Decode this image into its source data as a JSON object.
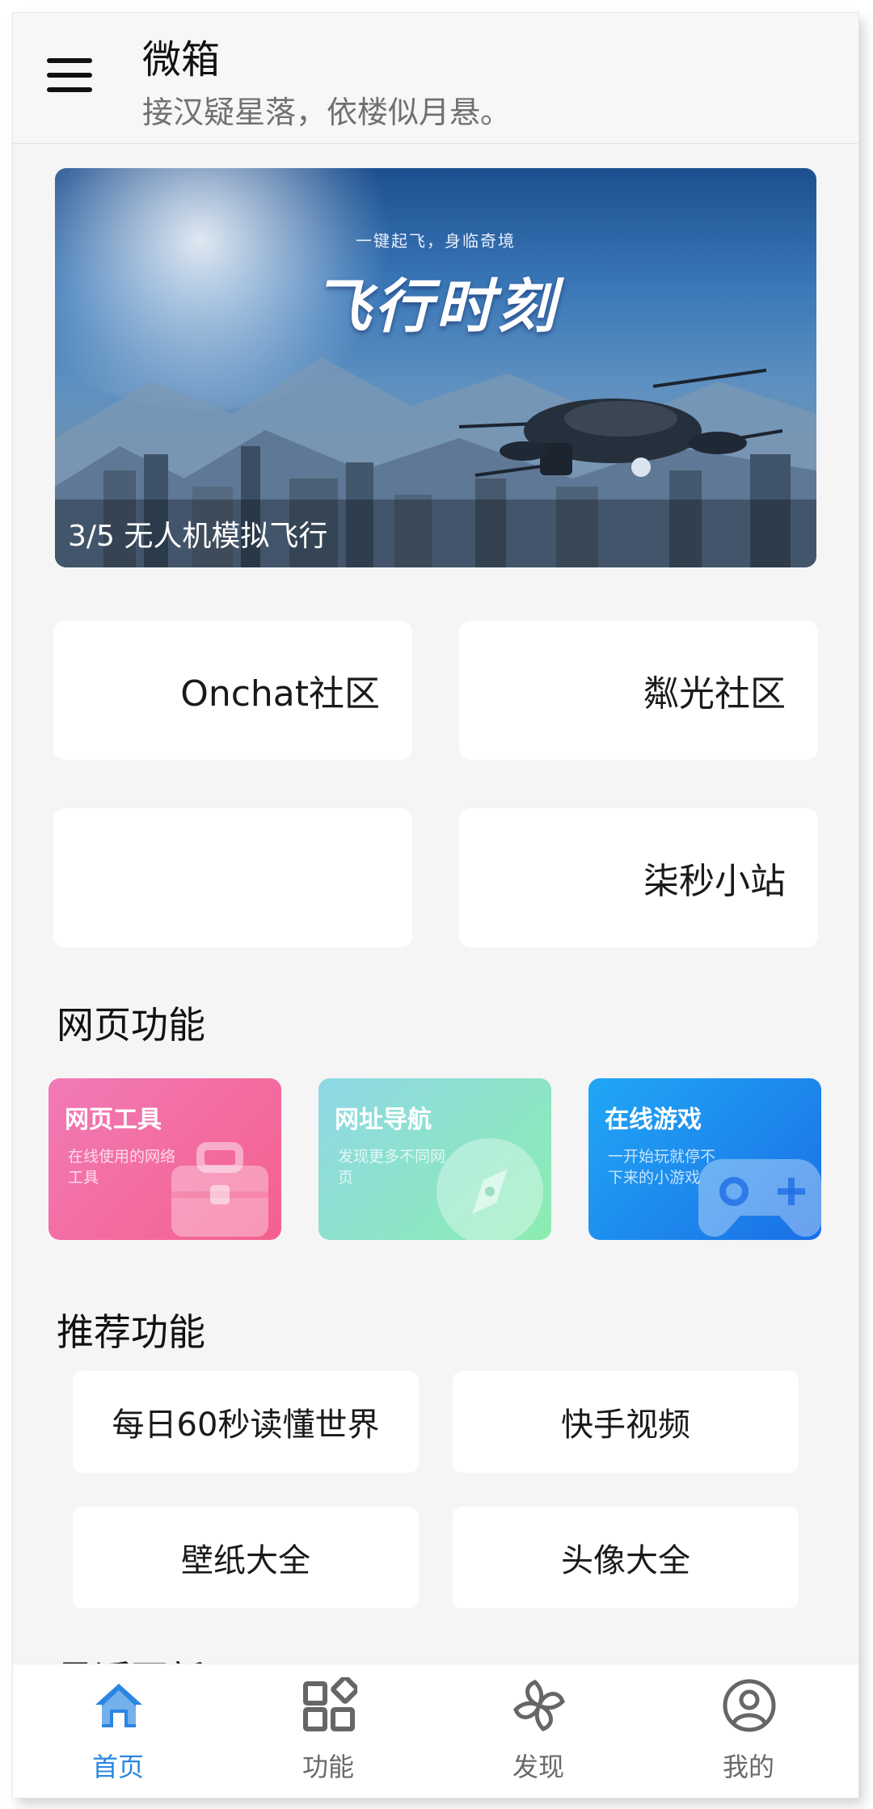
{
  "header": {
    "title": "微箱",
    "subtitle": "接汉疑星落，依楼似月悬。"
  },
  "banner": {
    "tagline": "一键起飞，身临奇境",
    "headline": "飞行时刻",
    "caption": "3/5 无人机模拟飞行"
  },
  "communities": [
    {
      "label": "Onchat社区"
    },
    {
      "label": "粼光社区"
    },
    {
      "label": ""
    },
    {
      "label": "柒秒小站"
    }
  ],
  "web_features": {
    "title": "网页功能",
    "cards": [
      {
        "title": "网页工具",
        "desc": "在线使用的网络工具",
        "icon": "toolbox-icon",
        "color": "#f06aa4"
      },
      {
        "title": "网址导航",
        "desc": "发现更多不同网页",
        "icon": "compass-icon",
        "color": "#7fe0b8"
      },
      {
        "title": "在线游戏",
        "desc": "一开始玩就停不下来的小游戏",
        "icon": "gamepad-icon",
        "color": "#1e88f0"
      }
    ]
  },
  "recommended": {
    "title": "推荐功能",
    "items": [
      {
        "label": "每日60秒读懂世界"
      },
      {
        "label": "快手视频"
      },
      {
        "label": "壁纸大全"
      },
      {
        "label": "头像大全"
      }
    ]
  },
  "recent": {
    "title": "最近更新"
  },
  "tabbar": {
    "active_color": "#2a86e2",
    "items": [
      {
        "label": "首页",
        "icon": "home-icon"
      },
      {
        "label": "功能",
        "icon": "apps-icon"
      },
      {
        "label": "发现",
        "icon": "pinwheel-icon"
      },
      {
        "label": "我的",
        "icon": "profile-icon"
      }
    ]
  }
}
